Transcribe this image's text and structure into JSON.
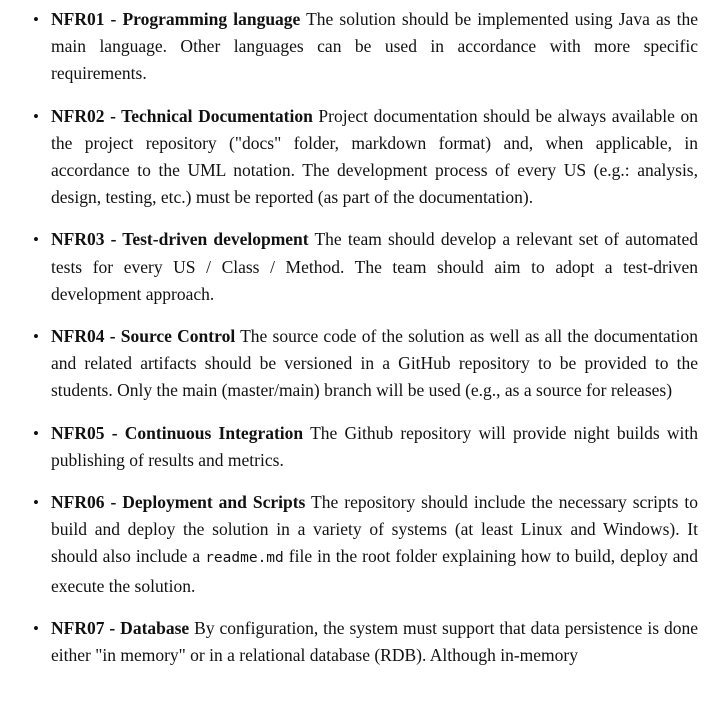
{
  "requirements": [
    {
      "title": "NFR01 - Programming language",
      "text": "The solution should be implemented using Java as the main language. Other languages can be used in accordance with more specific requirements."
    },
    {
      "title": "NFR02 - Technical Documentation",
      "text": "Project documentation should be always available on the project repository (\"docs\" folder, markdown format) and, when applicable, in accordance to the UML notation. The development process of every US (e.g.: analysis, design, testing, etc.) must be reported (as part of the documentation)."
    },
    {
      "title": "NFR03 - Test-driven development",
      "text": "The team should develop a relevant set of automated tests for every US / Class / Method. The team should aim to adopt a test-driven development approach."
    },
    {
      "title": "NFR04 - Source Control",
      "text": "The source code of the solution as well as all the documentation and related artifacts should be versioned in a GitHub repository to be provided to the students. Only the main (master/main) branch will be used (e.g., as a source for releases)"
    },
    {
      "title": "NFR05 - Continuous Integration",
      "text": "The Github repository will provide night builds with publishing of results and metrics."
    },
    {
      "title": "NFR06 - Deployment and Scripts",
      "text_before": "The repository should include the necessary scripts to build and deploy the solution in a variety of systems (at least Linux and Windows). It should also include a",
      "code": "readme.md",
      "text_after": "file in the root folder explaining how to build, deploy and execute the solution."
    },
    {
      "title": "NFR07 - Database",
      "text": "By configuration, the system must support that data persistence is done either \"in memory\" or in a relational database (RDB). Although in-memory"
    }
  ]
}
